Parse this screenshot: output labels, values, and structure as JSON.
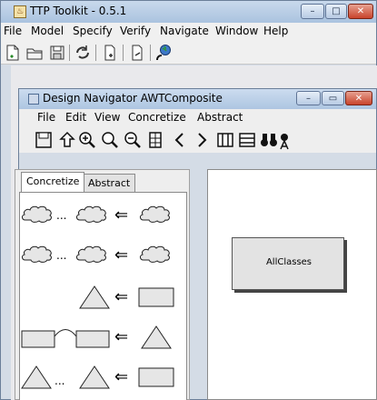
{
  "app": {
    "title": "TTP Toolkit - 0.5.1",
    "controls": {
      "minimize": "–",
      "maximize": "□",
      "close": "✕"
    }
  },
  "menu": [
    "File",
    "Model",
    "Specify",
    "Verify",
    "Navigate",
    "Window",
    "Help"
  ],
  "toolbar": [
    "new-document-icon",
    "open-folder-icon",
    "save-icon",
    "refresh-icon",
    "add-page-icon",
    "export-page-icon",
    "globe-icon"
  ],
  "inner_window": {
    "title": "Design Navigator AWTComposite",
    "controls": {
      "minimize": "–",
      "maximize": "▭",
      "close": "✕"
    },
    "menu": [
      "File",
      "Edit",
      "View",
      "Concretize",
      "Abstract"
    ],
    "toolbar": [
      "save-icon",
      "up-icon",
      "zoom-in-icon",
      "zoom-icon",
      "zoom-out-icon",
      "fit-icon",
      "back-icon",
      "forward-icon",
      "columns-icon",
      "rows-icon",
      "binoculars-icon",
      "find-text-icon"
    ]
  },
  "tabs": {
    "active": "Concretize",
    "inactive": "Abstract"
  },
  "palette": {
    "arrow": "⇐",
    "ellipsis": "...",
    "items": [
      "cloud-set-to-cloud",
      "cloud-set-to-cloud-2",
      "triangle-to-rectangle",
      "linked-rectangles-to-triangle",
      "triangle-set-to-rectangle"
    ]
  },
  "canvas": {
    "class_label": "AllClasses"
  }
}
